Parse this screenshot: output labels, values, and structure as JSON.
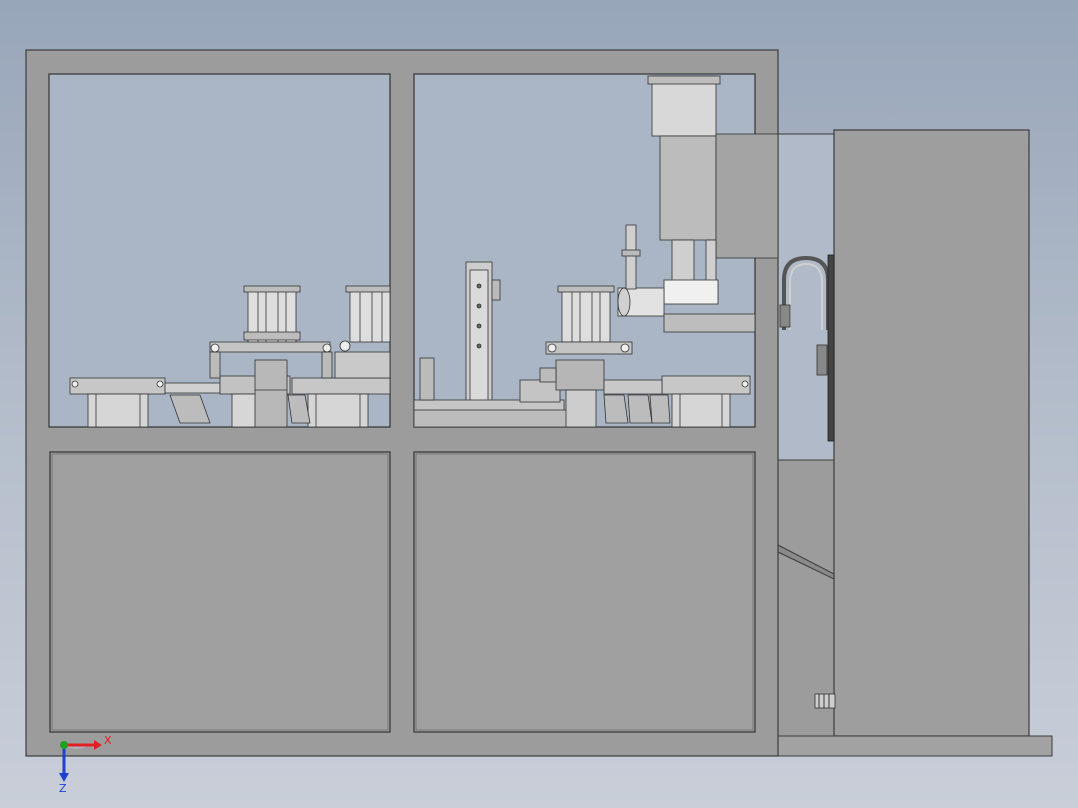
{
  "viewport": {
    "background_top": "#98a6ba",
    "background_bottom": "#c9ced9"
  },
  "model": {
    "frame_color": "#9c9c9c",
    "edge_color": "#3c3c3c",
    "window_tint": "#b0bccb",
    "panel_color": "#a0a0a0",
    "cabinet_color": "#9e9e9e"
  },
  "triad": {
    "x_label": "X",
    "z_label": "Z",
    "x_color": "#e02020",
    "z_color": "#2040d0",
    "origin_color": "#20a020"
  }
}
